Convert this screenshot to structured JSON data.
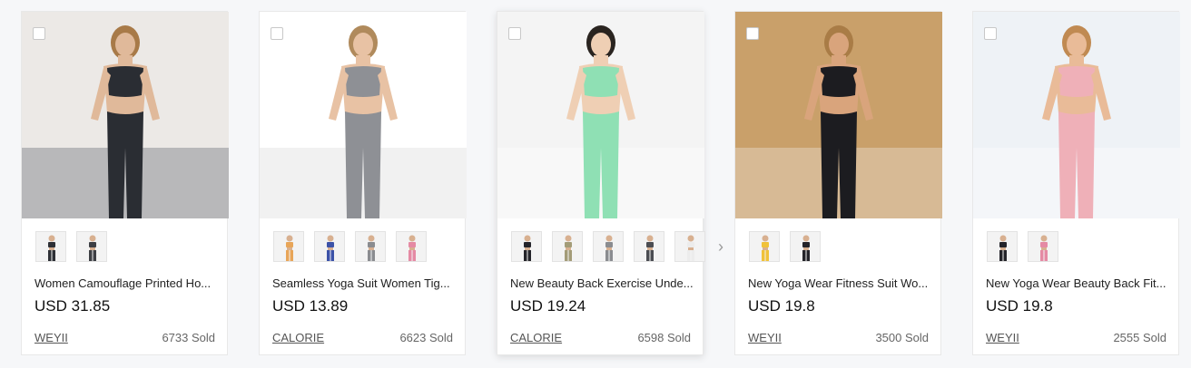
{
  "products": [
    {
      "title": "Women Camouflage Printed Ho...",
      "price": "USD 31.85",
      "brand": "WEYII",
      "sold": "6733 Sold",
      "image_icon": "product-photo-camouflage-suit",
      "thumbs": [
        "swatch-black-camo",
        "swatch-dark-camo"
      ],
      "colors": {
        "bg": "#ece9e6",
        "garment": "#2a2d33",
        "accent": "#5a5e66",
        "skin": "#e0b99a",
        "hair": "#a87a48"
      }
    },
    {
      "title": "Seamless Yoga Suit Women Tig...",
      "price": "USD 13.89",
      "brand": "CALORIE",
      "sold": "6623 Sold",
      "image_icon": "product-photo-grey-yoga-suit",
      "thumbs": [
        "swatch-orange",
        "swatch-blue",
        "swatch-grey",
        "swatch-pink"
      ],
      "colors": {
        "bg": "#ffffff",
        "garment": "#8e9095",
        "accent": "#d8d8d8",
        "skin": "#e8c2a4",
        "hair": "#b08a5c"
      }
    },
    {
      "title": "New Beauty Back Exercise Unde...",
      "price": "USD 19.24",
      "brand": "CALORIE",
      "sold": "6598 Sold",
      "image_icon": "product-photo-mint-shorts-set",
      "thumbs": [
        "swatch-black",
        "swatch-khaki",
        "swatch-grey",
        "swatch-charcoal",
        "swatch-white"
      ],
      "colors": {
        "bg": "#f4f4f4",
        "garment": "#8fe0b4",
        "accent": "#ffffff",
        "skin": "#efcfb4",
        "hair": "#2a2420"
      }
    },
    {
      "title": "New Yoga Wear Fitness Suit Wo...",
      "price": "USD 19.8",
      "brand": "WEYII",
      "sold": "3500 Sold",
      "image_icon": "product-photo-black-leggings-balcony",
      "thumbs": [
        "swatch-yellow",
        "swatch-black"
      ],
      "colors": {
        "bg": "#c9a06a",
        "garment": "#1c1c20",
        "accent": "#f1ece4",
        "skin": "#d9a47c",
        "hair": "#a97c46"
      }
    },
    {
      "title": "New Yoga Wear Beauty Back Fit...",
      "price": "USD 19.8",
      "brand": "WEYII",
      "sold": "2555 Sold",
      "image_icon": "product-photo-pink-yoga-set",
      "thumbs": [
        "swatch-black",
        "swatch-pink"
      ],
      "colors": {
        "bg": "#eef2f6",
        "garment": "#efb0b8",
        "accent": "#ffffff",
        "skin": "#e9bb98",
        "hair": "#c08a52"
      }
    }
  ],
  "thumb_colors": {
    "swatch-black-camo": "#2e3036",
    "swatch-dark-camo": "#3d3f44",
    "swatch-orange": "#e8a558",
    "swatch-blue": "#3c52a8",
    "swatch-grey": "#8a8c90",
    "swatch-pink": "#e58aa4",
    "swatch-black": "#24242a",
    "swatch-khaki": "#a39c78",
    "swatch-charcoal": "#4b4d52",
    "swatch-white": "#ececec",
    "swatch-yellow": "#f0c23a"
  }
}
